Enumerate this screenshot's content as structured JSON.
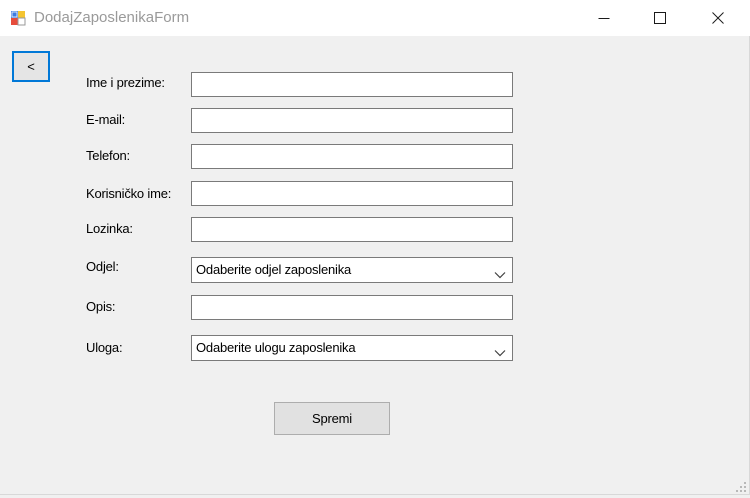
{
  "window": {
    "title": "DodajZaposlenikaForm"
  },
  "back_button": {
    "label": "<"
  },
  "form": {
    "name_label": "Ime i prezime:",
    "email_label": "E-mail:",
    "phone_label": "Telefon:",
    "username_label": "Korisničko ime:",
    "password_label": "Lozinka:",
    "department_label": "Odjel:",
    "department_value": "Odaberite odjel zaposlenika",
    "description_label": "Opis:",
    "role_label": "Uloga:",
    "role_value": "Odaberite ulogu zaposlenika",
    "save_label": "Spremi"
  },
  "colors": {
    "focus_border": "#0078d7",
    "window_background": "#f0f0f0",
    "titlebar_background": "#ffffff"
  },
  "icons": {
    "app": "form-app-icon",
    "minimize": "minimize-icon",
    "maximize": "maximize-icon",
    "close": "close-icon",
    "dropdown": "chevron-down-icon",
    "resize": "resize-grip-icon"
  }
}
